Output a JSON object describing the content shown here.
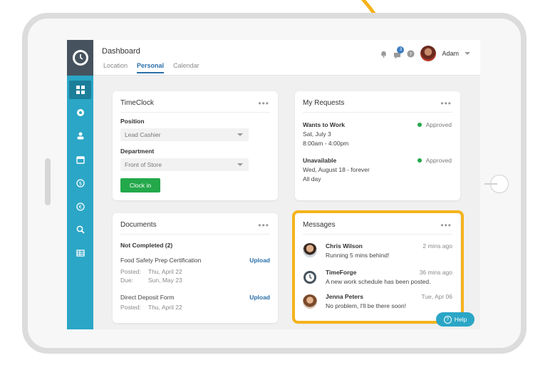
{
  "topbar": {
    "title": "Dashboard",
    "tabs": [
      {
        "label": "Location"
      },
      {
        "label": "Personal"
      },
      {
        "label": "Calendar"
      }
    ],
    "notification_count": "3",
    "user_name": "Adam"
  },
  "timeclock": {
    "title": "TimeClock",
    "more": "•••",
    "position_label": "Position",
    "position_value": "Lead Cashier",
    "department_label": "Department",
    "department_value": "Front of Store",
    "clock_in_label": "Clock in"
  },
  "requests": {
    "title": "My Requests",
    "more": "•••",
    "items": [
      {
        "type": "Wants to Work",
        "line1": "Sat, July 3",
        "line2": "8:00am - 4:00pm",
        "status": "Approved"
      },
      {
        "type": "Unavailable",
        "line1": "Wed, August 18 - forever",
        "line2": "All day",
        "status": "Approved"
      }
    ]
  },
  "documents": {
    "title": "Documents",
    "more": "•••",
    "section": "Not Completed (2)",
    "items": [
      {
        "name": "Food Safety Prep Certification",
        "action": "Upload",
        "posted_label": "Posted:",
        "posted": "Thu, April 22",
        "due_label": "Due:",
        "due": "Sun, May 23"
      },
      {
        "name": "Direct Deposit Form",
        "action": "Upload",
        "posted_label": "Posted:",
        "posted": "Thu, April 22"
      }
    ]
  },
  "messages": {
    "title": "Messages",
    "more": "•••",
    "items": [
      {
        "sender": "Chris Wilson",
        "time": "2 mins ago",
        "text": "Running 5 mins behind!"
      },
      {
        "sender": "TimeForge",
        "time": "36 mins ago",
        "text": "A new work schedule has been posted."
      },
      {
        "sender": "Jenna Peters",
        "time": "Tue, Apr 06",
        "text": "No problem, I'll be there soon!"
      }
    ]
  },
  "help": {
    "label": "Help"
  },
  "colors": {
    "sidebar": "#2ba6c6",
    "sidebar_active": "#1c7e99",
    "accent": "#2a6fa8",
    "approved": "#23a84a",
    "highlight": "#f5b31c"
  },
  "icons": [
    "clock-gear-icon",
    "dashboard-icon",
    "settings-icon",
    "users-icon",
    "calendar-icon",
    "dollar-icon",
    "euro-icon",
    "search-icon",
    "table-icon",
    "bell-icon",
    "chat-icon",
    "help-icon",
    "chevron-down-icon"
  ]
}
